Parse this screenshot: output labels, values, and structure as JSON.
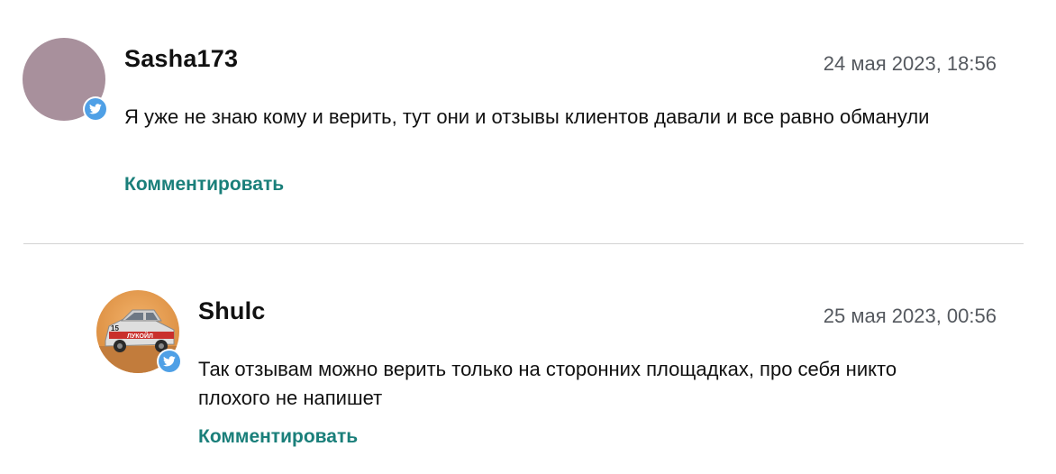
{
  "comments": [
    {
      "username": "Sasha173",
      "date": "24 мая 2023, 18:56",
      "text": "Я уже не знаю кому и верить, тут они и отзывы клиентов давали и все равно обманули",
      "reply_label": "Комментировать",
      "avatar_color": "#a8909c",
      "badge_icon": "twitter-bird-icon"
    },
    {
      "username": "Shulc",
      "date": "25 мая 2023, 00:56",
      "text": "Так отзывам можно верить только на сторонних площадках, про себя никто плохого не напишет",
      "reply_label": "Комментировать",
      "avatar_subject": "toy rally car photo",
      "badge_icon": "twitter-bird-icon"
    }
  ],
  "colors": {
    "accent": "#1a7f7a",
    "date_text": "#55595f",
    "divider": "#d2d2d2",
    "twitter_badge": "#4fa0e6"
  }
}
